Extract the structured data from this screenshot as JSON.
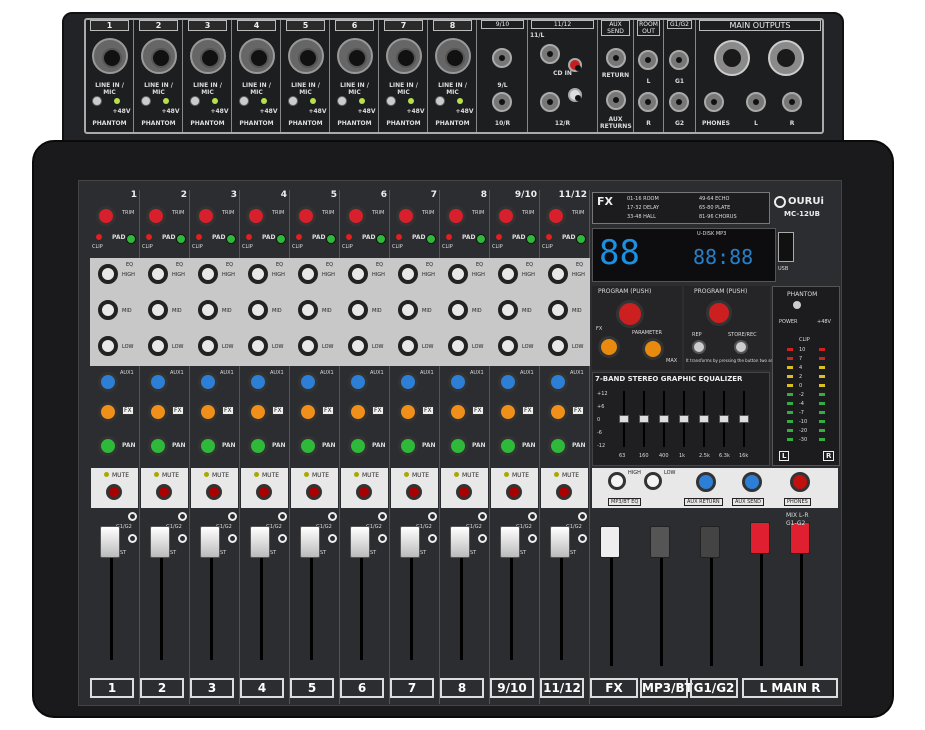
{
  "rear": {
    "channels": [
      "1",
      "2",
      "3",
      "4",
      "5",
      "6",
      "7",
      "8"
    ],
    "line_in_mic": "LINE IN / MIC",
    "phantom": "PHANTOM",
    "plus48v": "+48V",
    "stereo_sections": [
      "9/10",
      "11/12"
    ],
    "st_910_labels": [
      "9/L",
      "10/R"
    ],
    "st_1112_labels": [
      "11/L",
      "12/R",
      "CD IN"
    ],
    "aux_send": "AUX SEND",
    "return_label": "RETURN",
    "aux_returns": "AUX RETURNS",
    "room_out": "ROOM OUT",
    "g1g2": "G1/G2",
    "g1": "G1",
    "g2": "G2",
    "main_outputs": "MAIN OUTPUTS",
    "phones": "PHONES",
    "l": "L",
    "r": "R"
  },
  "brand": {
    "name": "OURUi",
    "model": "MC-12UB"
  },
  "channels": {
    "numbers": [
      "1",
      "2",
      "3",
      "4",
      "5",
      "6",
      "7",
      "8",
      "9/10",
      "11/12"
    ],
    "trim": "TRIM",
    "pad": "PAD",
    "clip": "CLIP",
    "eq_high": "HIGH",
    "eq_mid": "MID",
    "eq_low": "LOW",
    "eq": "EQ",
    "aux1": "AUX1",
    "fx": "FX",
    "pan": "PAN",
    "mute": "MUTE",
    "g1g2": "G1/G2",
    "st": "ST"
  },
  "fx": {
    "title": "FX",
    "presets": [
      "01-16 ROOM",
      "17-32 DELAY",
      "33-48 HALL",
      "49-64 ECHO",
      "65-80 PLATE",
      "81-96 CHORUS"
    ],
    "program_push": "PROGRAM (PUSH)",
    "parameter": "PARAMETER",
    "rep": "REP",
    "store_rec": "STORE/REC",
    "max": "MAX",
    "display_a": "88",
    "display_b": "88:88",
    "usb_player": "U-DISK MP3",
    "usb": "USB",
    "transform_note": "It transforms by pressing the button two second"
  },
  "geq": {
    "title": "7-BAND STEREO GRAPHIC EQUALIZER",
    "bands": [
      "63",
      "160",
      "400",
      "1k",
      "2.5k",
      "6.3k",
      "16k"
    ],
    "scale": [
      "+12",
      "+6",
      "0",
      "-6",
      "-12"
    ]
  },
  "meters": {
    "phantom": "PHANTOM",
    "power": "POWER",
    "p48": "+48V",
    "clip": "CLIP",
    "scale": [
      "10",
      "7",
      "4",
      "2",
      "0",
      "-2",
      "-4",
      "-7",
      "-10",
      "-20",
      "-30"
    ],
    "l": "L",
    "r": "R"
  },
  "master_row": {
    "mp3bt_eq": "MP3/BT EQ",
    "aux_return": "AUX RETURN",
    "aux_send": "AUX SEND",
    "phones": "PHONES",
    "high": "HIGH",
    "low": "LOW"
  },
  "bottom_labels": [
    "1",
    "2",
    "3",
    "4",
    "5",
    "6",
    "7",
    "8",
    "9/10",
    "11/12",
    "FX",
    "MP3/BT",
    "G1/G2",
    "L MAIN R"
  ],
  "mix_labels": [
    "MIX L-R",
    "G1-G2"
  ],
  "colors": {
    "trim": "#d8202c",
    "eq": "#e8e8e8",
    "aux": "#2d7fd6",
    "fx": "#f0901a",
    "pan": "#2fb93b",
    "mute": "#c01010",
    "main_fader": "#e02030",
    "fader_white": "#eeeeee"
  }
}
